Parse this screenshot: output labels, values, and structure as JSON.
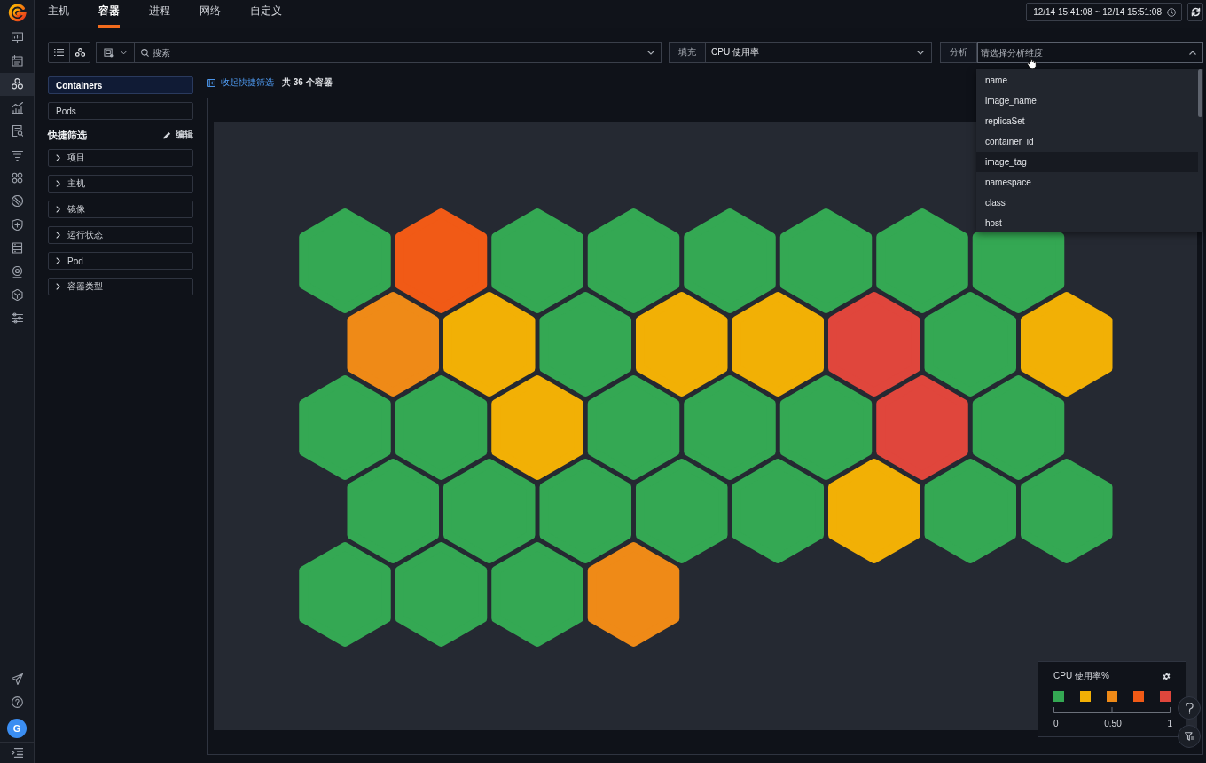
{
  "rail": {
    "items": [
      {
        "selected": false
      },
      {
        "selected": false
      },
      {
        "selected": true
      },
      {
        "selected": false
      },
      {
        "selected": false
      },
      {
        "selected": false
      },
      {
        "selected": false
      },
      {
        "selected": false
      },
      {
        "selected": false
      },
      {
        "selected": false
      },
      {
        "selected": false
      },
      {
        "selected": false
      },
      {
        "selected": false
      }
    ],
    "user_initial": "G"
  },
  "tabs": [
    {
      "label": "主机",
      "selected": false
    },
    {
      "label": "容器",
      "selected": true
    },
    {
      "label": "进程",
      "selected": false
    },
    {
      "label": "网络",
      "selected": false
    },
    {
      "label": "自定义",
      "selected": false
    }
  ],
  "time_range": "12/14 15:41:08 ~ 12/14 15:51:08",
  "toolbar": {
    "search": {
      "placeholder": "搜索"
    },
    "fill": {
      "label": "填充",
      "value": "CPU 使用率"
    },
    "analysis": {
      "label": "分析",
      "placeholder": "请选择分析维度",
      "expanded": true,
      "options": [
        {
          "label": "name",
          "highlighted": false
        },
        {
          "label": "image_name",
          "highlighted": false
        },
        {
          "label": "replicaSet",
          "highlighted": false
        },
        {
          "label": "container_id",
          "highlighted": false
        },
        {
          "label": "image_tag",
          "highlighted": true
        },
        {
          "label": "namespace",
          "highlighted": false
        },
        {
          "label": "class",
          "highlighted": false
        },
        {
          "label": "host",
          "highlighted": false
        }
      ]
    }
  },
  "object_types": [
    {
      "label": "Containers",
      "selected": true
    },
    {
      "label": "Pods",
      "selected": false
    }
  ],
  "quick_filters": {
    "title": "快捷筛选",
    "edit": "编辑",
    "groups": [
      {
        "label": "项目",
        "expanded": false
      },
      {
        "label": "主机",
        "expanded": false
      },
      {
        "label": "镜像",
        "expanded": false
      },
      {
        "label": "运行状态",
        "expanded": false
      },
      {
        "label": "Pod",
        "expanded": false
      },
      {
        "label": "容器类型",
        "expanded": false
      }
    ]
  },
  "collapse_link": "收起快捷筛选",
  "count": "共 36 个容器",
  "hex_map": {
    "rows": [
      [
        {
          "color": "#34a853"
        },
        {
          "color": "#f15a16"
        },
        {
          "color": "#34a853"
        },
        {
          "color": "#34a853"
        },
        {
          "color": "#34a853"
        },
        {
          "color": "#34a853"
        },
        {
          "color": "#34a853"
        },
        {
          "color": "#34a853"
        }
      ],
      [
        {
          "color": "#ef8a17"
        },
        {
          "color": "#f2b005"
        },
        {
          "color": "#34a853"
        },
        {
          "color": "#f2b005"
        },
        {
          "color": "#f2b005"
        },
        {
          "color": "#e0463c"
        },
        {
          "color": "#34a853"
        },
        {
          "color": "#f2b005"
        }
      ],
      [
        {
          "color": "#34a853"
        },
        {
          "color": "#34a853"
        },
        {
          "color": "#f2b005"
        },
        {
          "color": "#34a853"
        },
        {
          "color": "#34a853"
        },
        {
          "color": "#34a853"
        },
        {
          "color": "#e0463c"
        },
        {
          "color": "#34a853"
        }
      ],
      [
        {
          "color": "#34a853"
        },
        {
          "color": "#34a853"
        },
        {
          "color": "#34a853"
        },
        {
          "color": "#34a853"
        },
        {
          "color": "#34a853"
        },
        {
          "color": "#f2b005"
        },
        {
          "color": "#34a853"
        },
        {
          "color": "#34a853"
        }
      ],
      [
        {
          "color": "#34a853"
        },
        {
          "color": "#34a853"
        },
        {
          "color": "#34a853"
        },
        {
          "color": "#ef8a17"
        }
      ]
    ]
  },
  "legend": {
    "title": "CPU 使用率%",
    "swatches": [
      {
        "color": "#34a853"
      },
      {
        "color": "#f2b005"
      },
      {
        "color": "#ef8a17"
      },
      {
        "color": "#f15a16"
      },
      {
        "color": "#e0463c"
      }
    ],
    "scale_labels": [
      "0",
      "0.50",
      "1"
    ]
  }
}
